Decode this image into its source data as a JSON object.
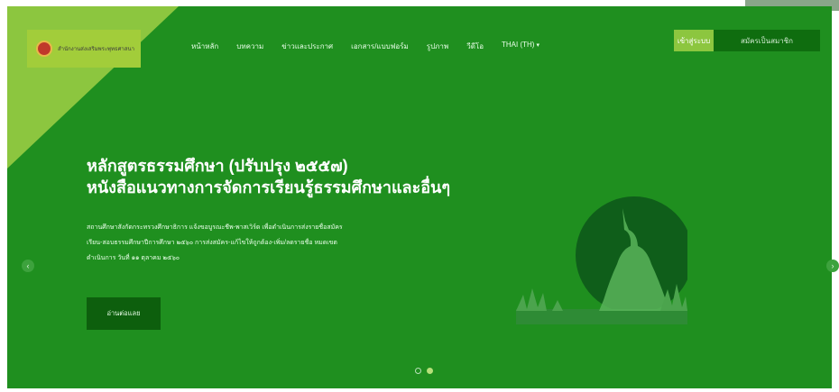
{
  "logo": {
    "text": "สำนักงานส่งเสริมพระพุทธศาสนา"
  },
  "nav": {
    "items": [
      "หน้าหลัก",
      "บทความ",
      "ข่าวและประกาศ",
      "เอกสาร/แบบฟอร์ม",
      "รูปภาพ",
      "วีดีโอ"
    ],
    "language": "THAI (TH)"
  },
  "auth": {
    "login_label": "เข้าสู่ระบบ",
    "register_label": "สมัครเป็นสมาชิก"
  },
  "hero": {
    "title_line1": "หลักสูตรธรรมศึกษา (ปรับปรุง ๒๕๕๗)",
    "title_line2": "หนังสือแนวทางการจัดการเรียนรู้ธรรมศึกษาและอื่นๆ",
    "desc_line1": "สถานศึกษาสังกัดกระทรวงศึกษาธิการ แจ้งขอบูรณะชีพ-พาสเวิร์ด เพื่อดำเนินการส่งรายชื่อสมัคร",
    "desc_line2": "เรียน-สอบธรรมศึกษาปีการศึกษา ๒๕๖๐ การส่งสมัคร-แก้ไขให้ถูกต้อง-เพิ่ม/ลดรายชื่อ หมดเขต",
    "desc_line3": "ดำเนินการ วันที่ ๑๑ ตุลาคม ๒๕๖๐",
    "read_more": "อ่านต่อแลย"
  },
  "carousel": {
    "slide_count": 2,
    "active_index": 1
  },
  "colors": {
    "background": "#1f8f1f",
    "accent": "#8cc63f",
    "dark": "#0d5f0d"
  }
}
